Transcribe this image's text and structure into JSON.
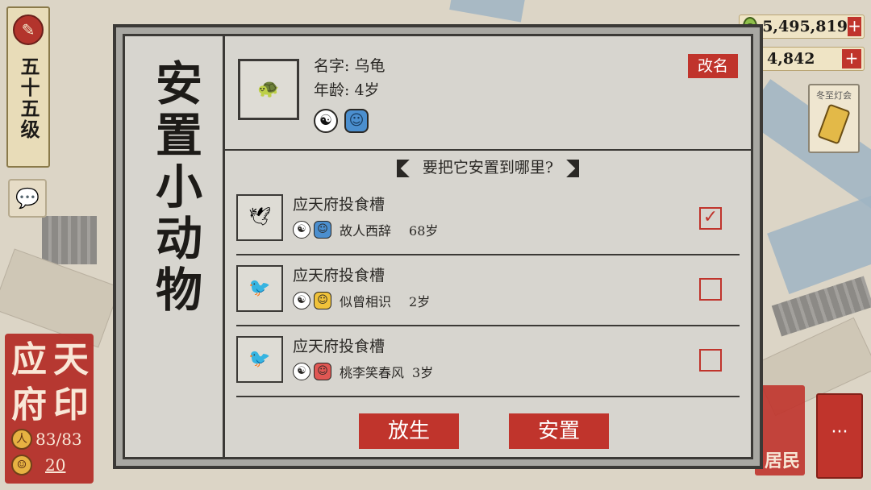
{
  "hud": {
    "rank_label": "五十五级",
    "seal": {
      "chars": [
        "应",
        "天",
        "府",
        "印"
      ],
      "population": "83/83",
      "count": "20"
    },
    "coins": "5,495,819",
    "gems": "4,842",
    "event_label": "冬至灯会",
    "resident_label": "居民",
    "more_label": "···"
  },
  "panel": {
    "title": "安置小动物",
    "animal": {
      "name_line": "名字: 乌龟",
      "age_line": "年龄:  4岁",
      "rename": "改名"
    },
    "question": "要把它安置到哪里?",
    "slots": [
      {
        "place": "应天府投食槽",
        "animal_name": "故人西辞",
        "age": "68岁",
        "checked": true
      },
      {
        "place": "应天府投食槽",
        "animal_name": "似曾相识",
        "age": "2岁",
        "checked": false
      },
      {
        "place": "应天府投食槽",
        "animal_name": "桃李笑春风",
        "age": "3岁",
        "checked": false
      }
    ],
    "release_button": "放生",
    "place_button": "安置"
  },
  "colors": {
    "accent_red": "#c0342c",
    "ink": "#2a2825",
    "panel_bg": "#d7d5cf"
  }
}
